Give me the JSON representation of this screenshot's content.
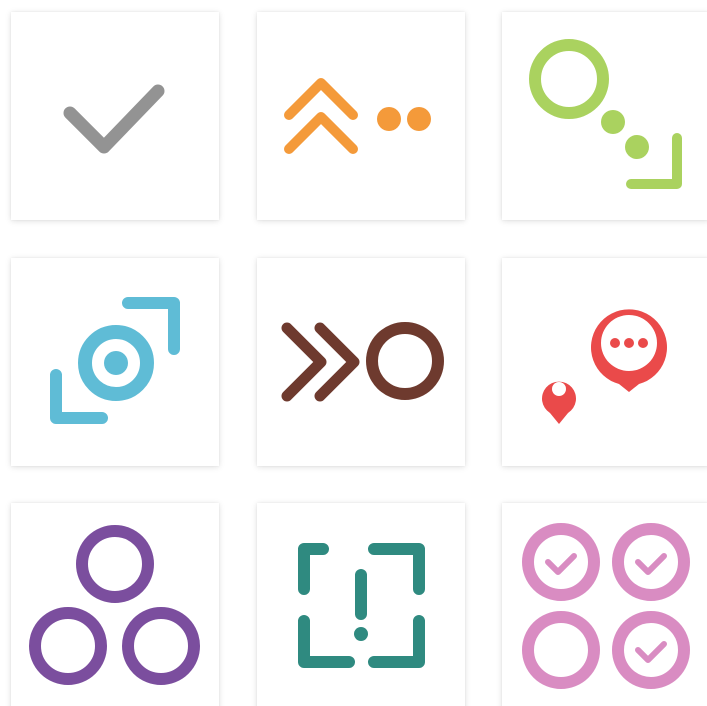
{
  "colors": {
    "gray": "#939393",
    "orange": "#f49a3a",
    "green": "#aad25f",
    "blue": "#5fbcd6",
    "brown": "#6e3a2e",
    "red": "#ea4a4a",
    "purple": "#7b4e9e",
    "teal": "#2f8a80",
    "pink": "#d98cc2"
  },
  "tiles": [
    {
      "icon": "checkmark-icon"
    },
    {
      "icon": "double-chevron-up-dots-icon"
    },
    {
      "icon": "circle-dots-corner-icon"
    },
    {
      "icon": "target-expand-icon"
    },
    {
      "icon": "double-chevron-right-circle-icon"
    },
    {
      "icon": "location-chat-bubble-icon"
    },
    {
      "icon": "three-circles-icon"
    },
    {
      "icon": "bracket-exclamation-icon"
    },
    {
      "icon": "circles-checks-grid-icon"
    }
  ]
}
